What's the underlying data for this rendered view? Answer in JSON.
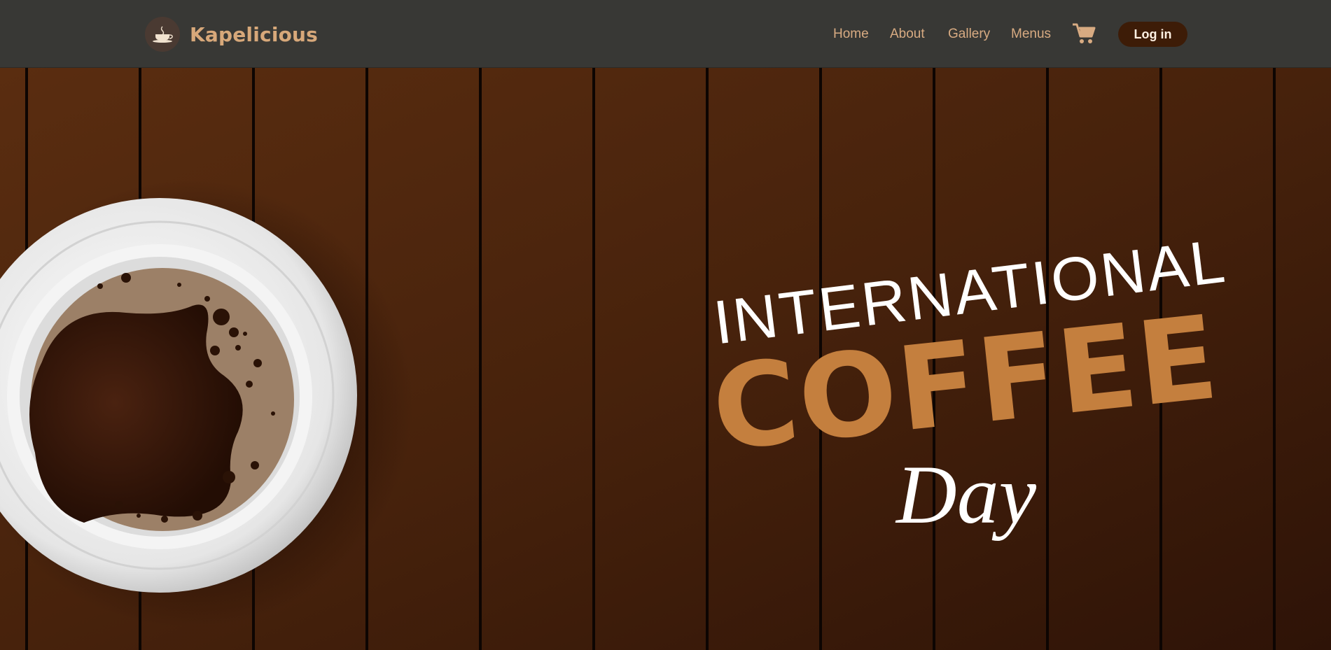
{
  "brand": {
    "name": "Kapelicious",
    "logo_icon": "coffee-cup-logo-icon"
  },
  "nav": {
    "home": "Home",
    "about": "About",
    "gallery": "Gallery",
    "menus": "Menus",
    "cart_icon": "shopping-cart-icon",
    "login": "Log in"
  },
  "hero": {
    "line1": "INTERNATIONAL",
    "line2": "COFFEE",
    "line3": "Day"
  },
  "colors": {
    "navbar": "#383835",
    "accent": "#d8ab82",
    "coffee_text": "#c47f3e",
    "wood": "#4a2310",
    "button": "#3d1c07"
  }
}
